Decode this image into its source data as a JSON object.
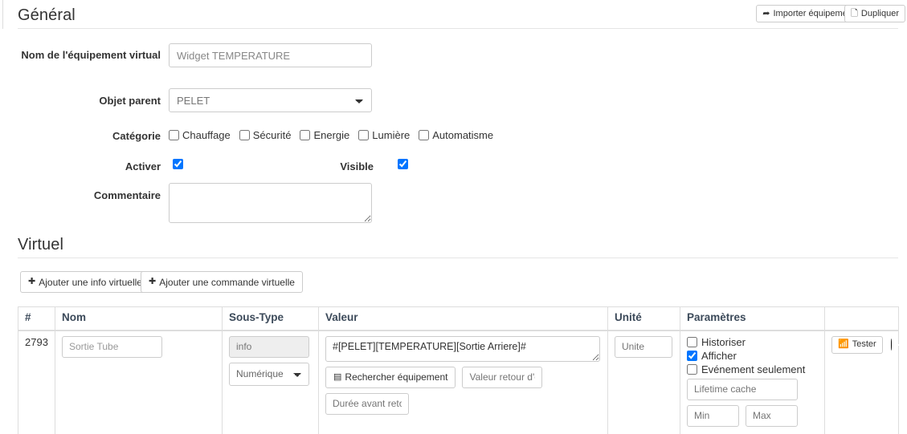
{
  "header": {
    "title": "Général",
    "actions": [
      {
        "label": "Importer équipement",
        "icon": "share-arrow-icon"
      },
      {
        "label": "Dupliquer",
        "icon": "copy-icon"
      }
    ]
  },
  "form": {
    "name_label": "Nom de l'équipement virtual",
    "name_value": "Widget TEMPERATURE",
    "parent_label": "Objet parent",
    "parent_value": "PELET",
    "category_label": "Catégorie",
    "categories": [
      {
        "label": "Chauffage",
        "checked": false
      },
      {
        "label": "Sécurité",
        "checked": false
      },
      {
        "label": "Energie",
        "checked": false
      },
      {
        "label": "Lumière",
        "checked": false
      },
      {
        "label": "Automatisme",
        "checked": false
      }
    ],
    "activate_label": "Activer",
    "activate_checked": true,
    "visible_label": "Visible",
    "visible_checked": true,
    "comment_label": "Commentaire",
    "comment_value": ""
  },
  "virtual": {
    "title": "Virtuel",
    "add_info_label": "Ajouter une info virtuelle",
    "add_command_label": "Ajouter une commande virtuelle",
    "add_icon": "plus-circle-icon",
    "columns": [
      "#",
      "Nom",
      "Sous-Type",
      "Valeur",
      "Unité",
      "Paramètres",
      ""
    ],
    "rows": [
      {
        "id": "2793",
        "name_value": "Sortie Tube",
        "name_placeholder": "Nom",
        "type_static": "info",
        "subtype_value": "Numérique",
        "value_text": "#[PELET][TEMPERATURE][Sortie Arriere]#",
        "search_button": "Rechercher équipement",
        "search_icon": "list-box-icon",
        "state_return_placeholder": "Valeur retour d'état",
        "delay_placeholder": "Durée avant retour",
        "unit_placeholder": "Unite",
        "params": [
          {
            "label": "Historiser",
            "checked": false
          },
          {
            "label": "Afficher",
            "checked": true
          },
          {
            "label": "Evénement seulement",
            "checked": false
          }
        ],
        "cache_placeholder": "Lifetime cache",
        "min_placeholder": "Min",
        "max_placeholder": "Max",
        "test_label": "Tester",
        "test_icon": "rss-signal-icon",
        "remove_icon": "minus-circle-icon"
      }
    ]
  },
  "colors": {
    "border": "#dddddd",
    "text": "#333333",
    "muted": "#999999",
    "header_text": "#3c4a5a"
  }
}
